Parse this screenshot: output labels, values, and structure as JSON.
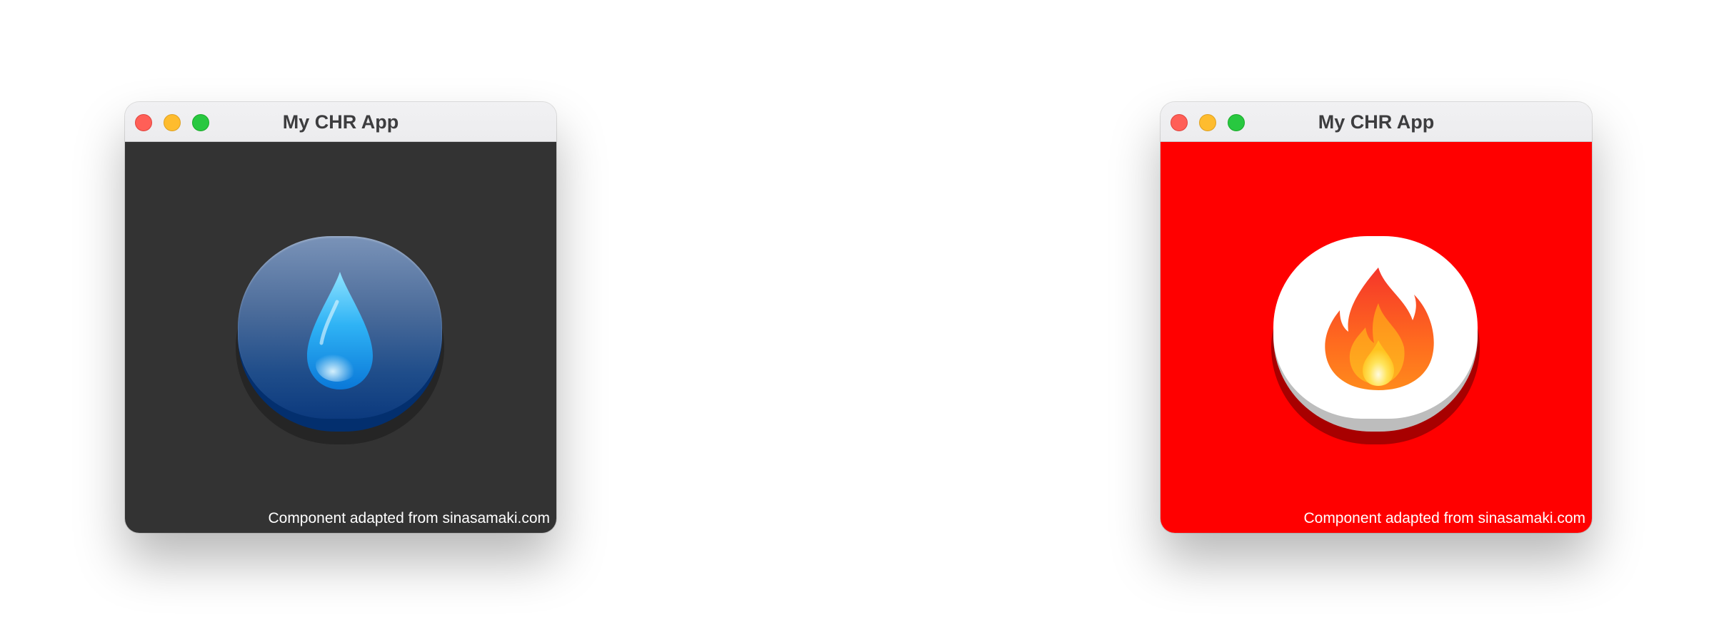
{
  "windows": [
    {
      "title": "My CHR App",
      "background_color": "#333333",
      "button": {
        "variant": "water",
        "icon": "water-drop-icon",
        "face_color": "#4d6d9b",
        "base_color": "#032f6e"
      },
      "credit": "Component adapted from sinasamaki.com"
    },
    {
      "title": "My CHR App",
      "background_color": "#ff0000",
      "button": {
        "variant": "fire",
        "icon": "fire-icon",
        "face_color": "#ffffff",
        "base_color": "#bdbdbd"
      },
      "credit": "Component adapted from sinasamaki.com"
    }
  ],
  "traffic_light_colors": {
    "close": "#ff5f57",
    "minimize": "#febc2e",
    "zoom": "#28c840"
  }
}
